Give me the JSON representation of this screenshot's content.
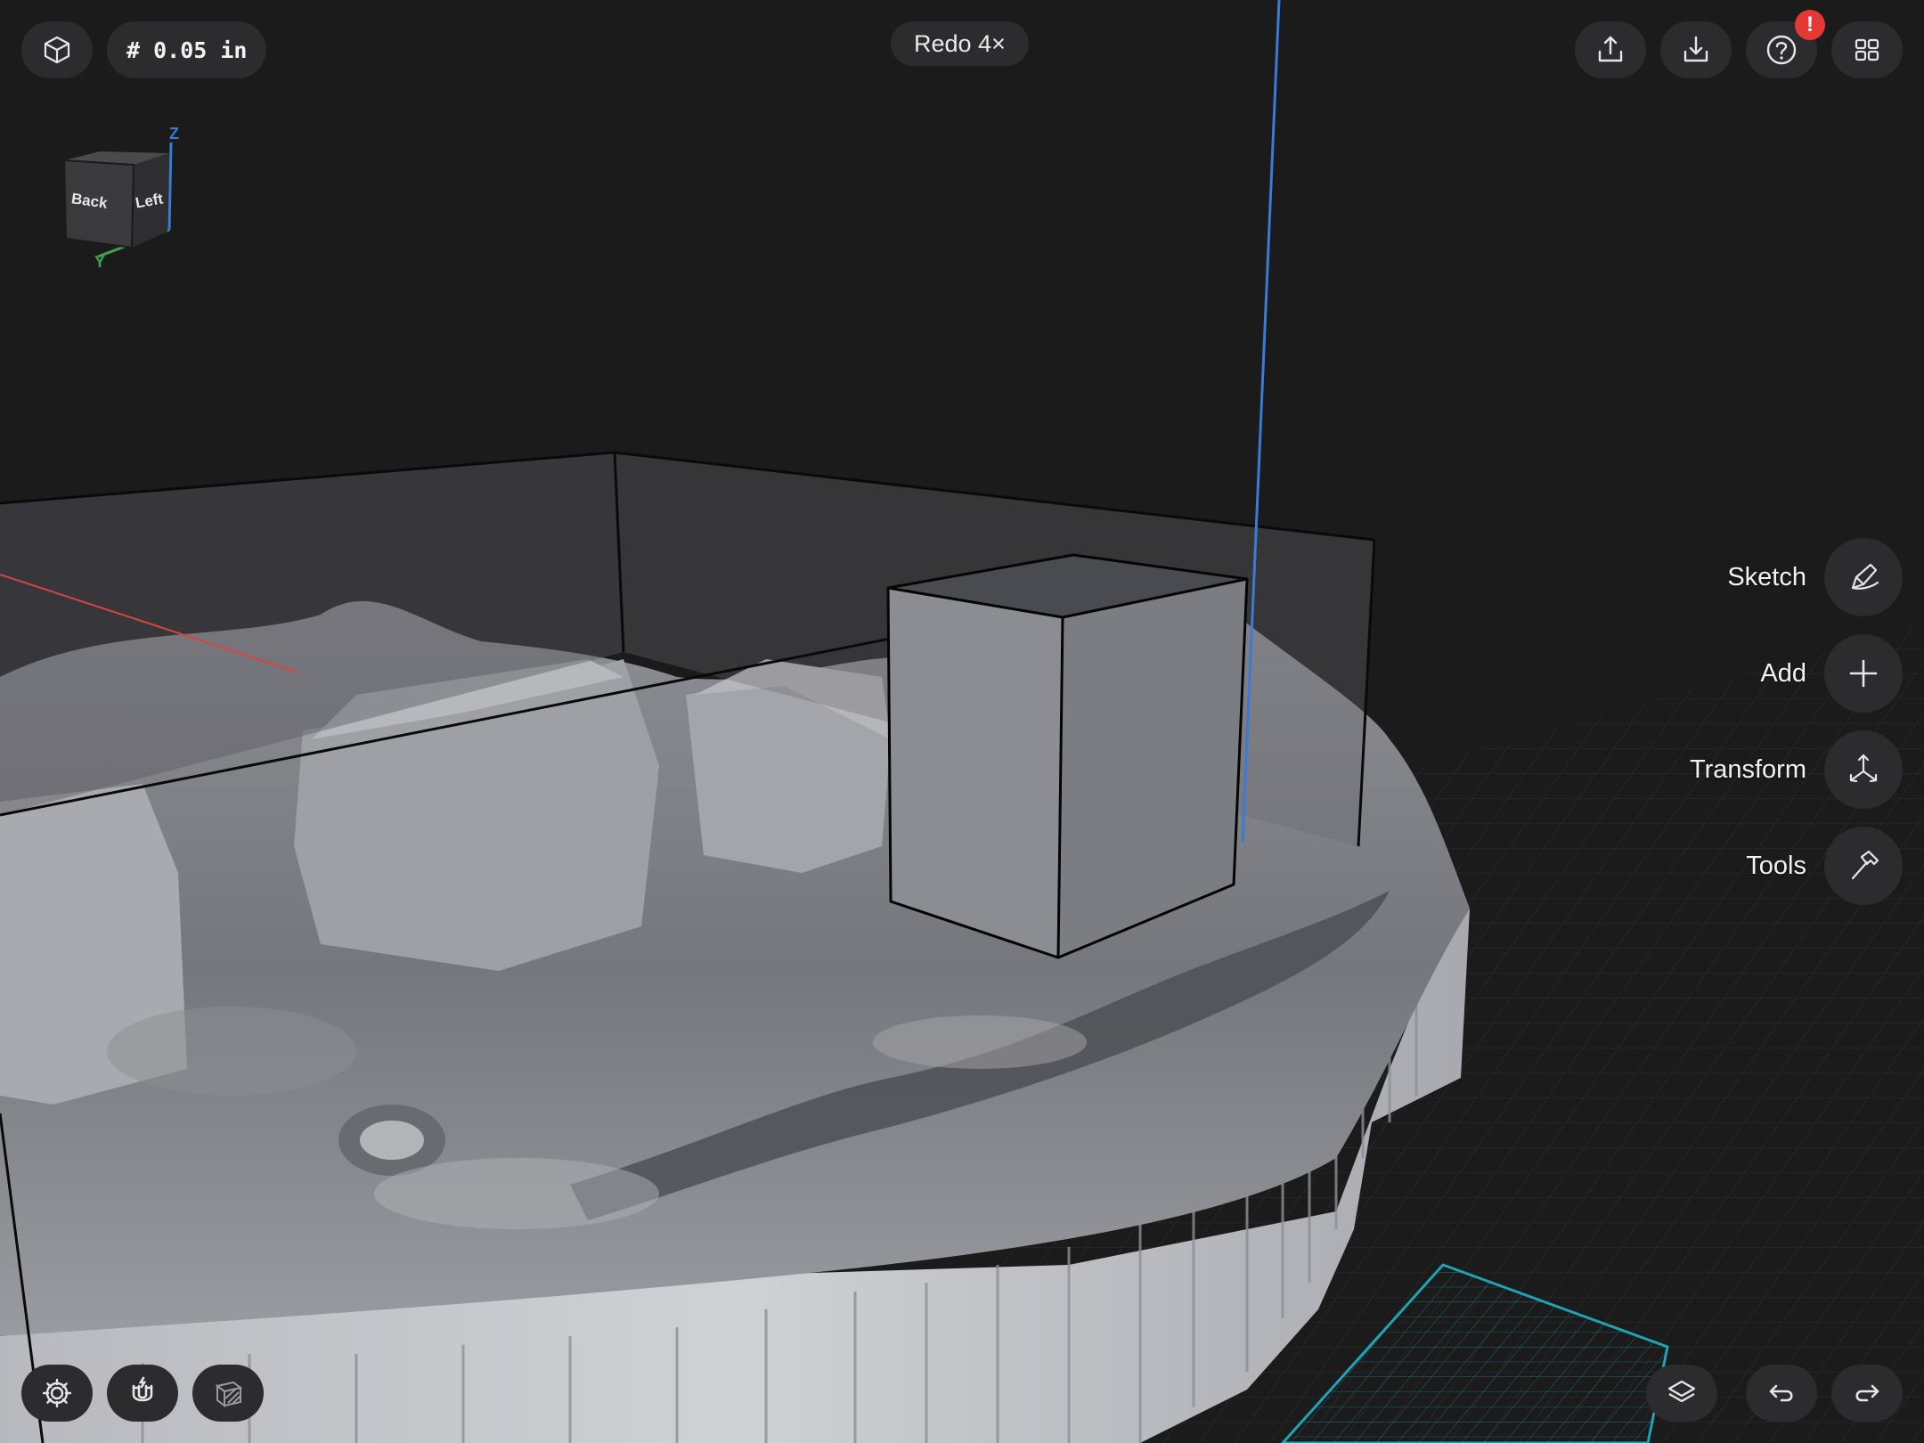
{
  "toolbar": {
    "grid_readout": "# 0.05 in",
    "redo_label": "Redo 4×",
    "help_badge": "!"
  },
  "view_cube": {
    "face_back": "Back",
    "face_left": "Left",
    "axis_z": "Z",
    "axis_y": "Y"
  },
  "side_menu": [
    {
      "label": "Sketch",
      "icon": "pen-icon"
    },
    {
      "label": "Add",
      "icon": "plus-icon"
    },
    {
      "label": "Transform",
      "icon": "transform-arrows-icon"
    },
    {
      "label": "Tools",
      "icon": "hammer-icon"
    }
  ],
  "colors": {
    "background": "#1b1b1c",
    "button": "#2c2c2e",
    "axis_z": "#3a7bd5",
    "axis_x": "#d64541",
    "axis_y": "#3fa34d",
    "badge": "#e53935",
    "selection_grid": "#1fa3b5"
  }
}
